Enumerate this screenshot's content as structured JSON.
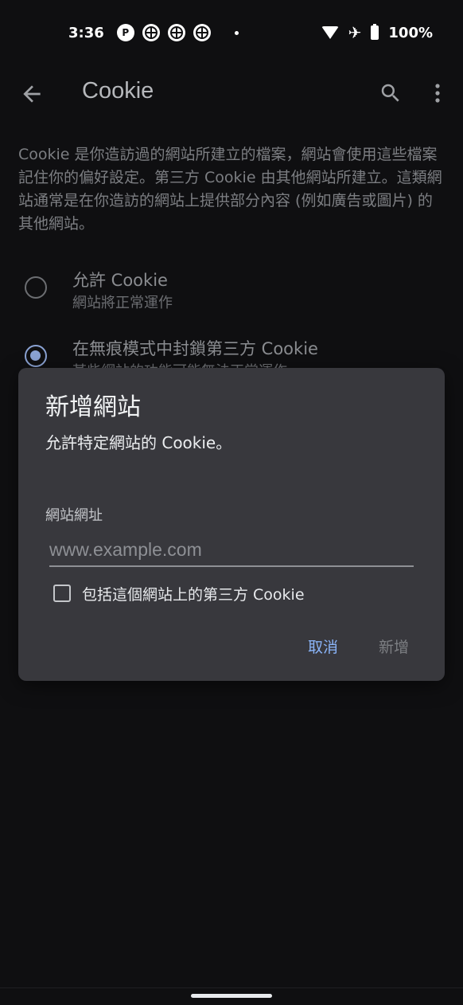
{
  "status_bar": {
    "time": "3:36",
    "battery": "100%",
    "icons": [
      "app-notification-icon",
      "basketball-icon",
      "basketball-icon",
      "basketball-icon",
      "dot-icon",
      "wifi-icon",
      "airplane-mode-icon",
      "battery-charging-icon"
    ]
  },
  "app_bar": {
    "title": "Cookie"
  },
  "background": {
    "description": "Cookie 是你造訪過的網站所建立的檔案，網站會使用這些檔案記住你的偏好設定。第三方 Cookie 由其他網站所建立。這類網站通常是在你造訪的網站上提供部分內容 (例如廣告或圖片) 的其他網站。",
    "options": [
      {
        "title": "允許 Cookie",
        "subtitle": "網站將正常運作",
        "selected": false
      },
      {
        "title": "在無痕模式中封鎖第三方 Cookie",
        "subtitle": "某些網站的功能可能無法正常運作",
        "selected": true
      }
    ]
  },
  "dialog": {
    "title": "新增網站",
    "message": "允許特定網站的 Cookie。",
    "field_label": "網站網址",
    "url_placeholder": "www.example.com",
    "url_value": "",
    "checkbox_label": "包括這個網站上的第三方 Cookie",
    "checkbox_checked": false,
    "cancel_label": "取消",
    "add_label": "新增"
  },
  "colors": {
    "accent": "#8ab4f8",
    "dialog_bg": "#38383d",
    "page_bg": "#0f0f11"
  }
}
